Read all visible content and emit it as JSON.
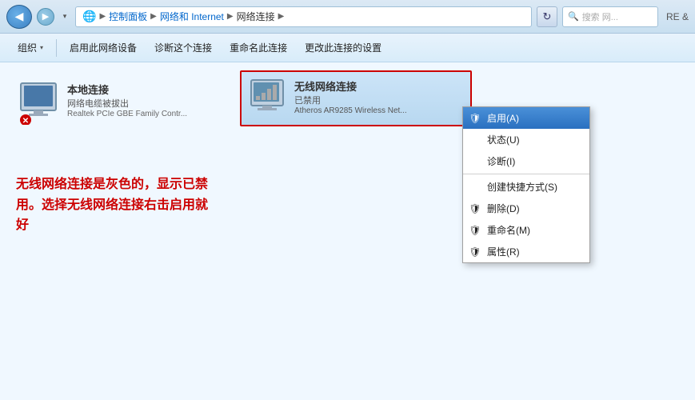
{
  "addressBar": {
    "breadcrumbs": [
      "控制面板",
      "网络和 Internet",
      "网络连接"
    ],
    "separators": [
      "▶",
      "▶",
      "▶"
    ],
    "searchPlaceholder": "搜索 网...",
    "refreshTitle": "刷新"
  },
  "toolbar": {
    "items": [
      {
        "label": "组织",
        "hasArrow": true,
        "key": "organize"
      },
      {
        "label": "启用此网络设备",
        "hasArrow": false,
        "key": "enable-device"
      },
      {
        "label": "诊断这个连接",
        "hasArrow": false,
        "key": "diagnose"
      },
      {
        "label": "重命名此连接",
        "hasArrow": false,
        "key": "rename"
      },
      {
        "label": "更改此连接的设置",
        "hasArrow": false,
        "key": "change-settings"
      }
    ]
  },
  "connections": {
    "local": {
      "name": "本地连接",
      "status": "网络电缆被拔出",
      "adapter": "Realtek PCIe GBE Family Contr..."
    },
    "wireless": {
      "name": "无线网络连接",
      "status": "已禁用",
      "adapter": "Atheros AR9285 Wireless Net..."
    }
  },
  "contextMenu": {
    "items": [
      {
        "label": "启用(A)",
        "highlighted": true,
        "hasShield": true,
        "key": "enable"
      },
      {
        "label": "状态(U)",
        "highlighted": false,
        "hasShield": false,
        "key": "status"
      },
      {
        "label": "诊断(I)",
        "highlighted": false,
        "hasShield": false,
        "key": "diagnose"
      },
      {
        "separator": true
      },
      {
        "label": "创建快捷方式(S)",
        "highlighted": false,
        "hasShield": false,
        "key": "shortcut"
      },
      {
        "label": "删除(D)",
        "highlighted": false,
        "hasShield": true,
        "key": "delete"
      },
      {
        "label": "重命名(M)",
        "highlighted": false,
        "hasShield": true,
        "key": "rename"
      },
      {
        "label": "属性(R)",
        "highlighted": false,
        "hasShield": true,
        "key": "properties"
      }
    ]
  },
  "annotation": {
    "text": "无线网络连接是灰色的，显示已禁用。选择无线网络连接右击启用就好"
  },
  "topRight": {
    "label": "RE &"
  }
}
